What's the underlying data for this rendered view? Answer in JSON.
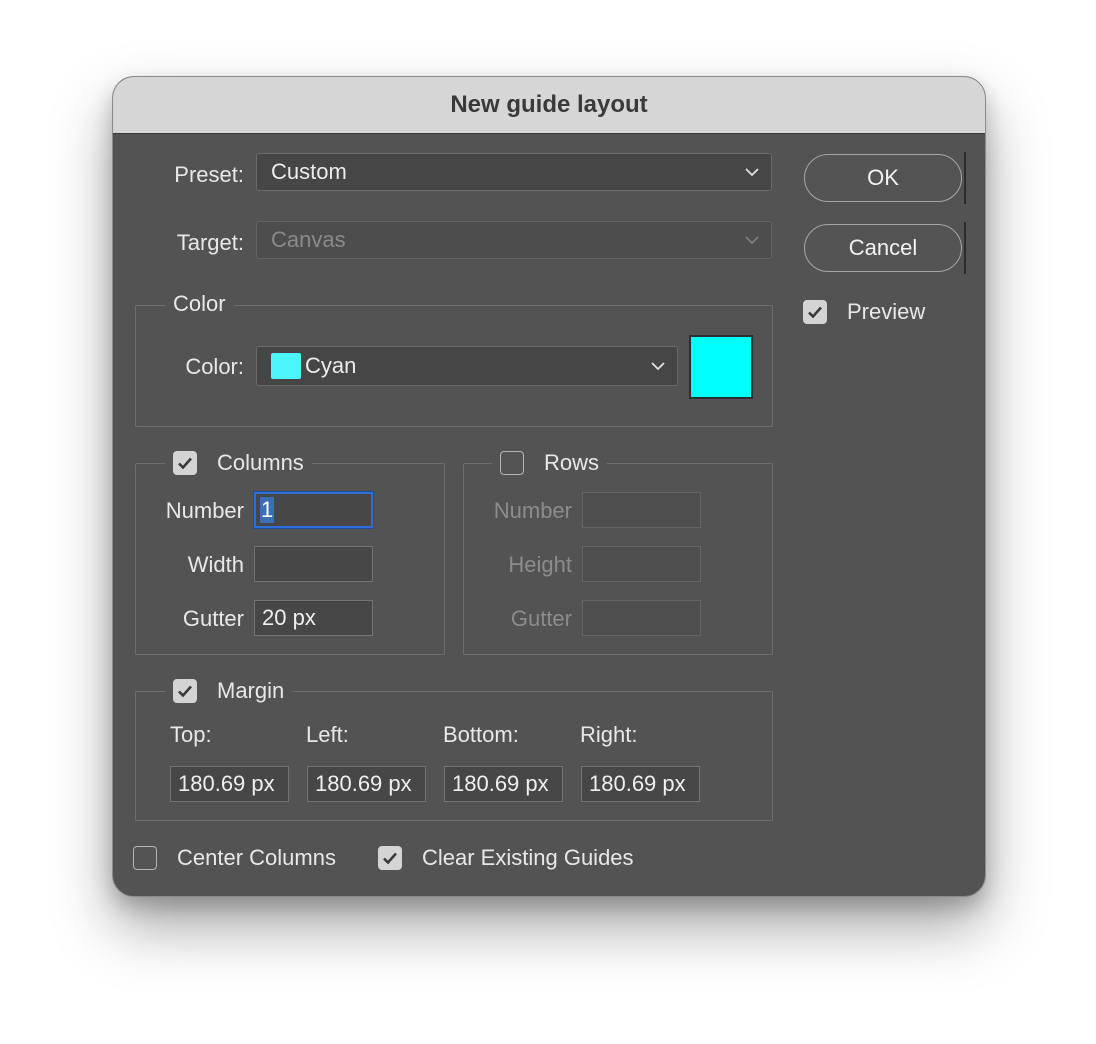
{
  "dialog": {
    "title": "New guide layout",
    "preset": {
      "label": "Preset:",
      "value": "Custom"
    },
    "target": {
      "label": "Target:",
      "value": "Canvas"
    },
    "color_group": {
      "legend": "Color",
      "label": "Color:",
      "value": "Cyan",
      "swatch_color": "#00ffff"
    },
    "columns": {
      "legend": "Columns",
      "checked": true,
      "number_label": "Number",
      "number_value": "1",
      "width_label": "Width",
      "width_value": "",
      "gutter_label": "Gutter",
      "gutter_value": "20 px"
    },
    "rows": {
      "legend": "Rows",
      "checked": false,
      "number_label": "Number",
      "height_label": "Height",
      "gutter_label": "Gutter"
    },
    "margin": {
      "legend": "Margin",
      "checked": true,
      "top_label": "Top:",
      "left_label": "Left:",
      "bottom_label": "Bottom:",
      "right_label": "Right:",
      "top_value": "180.69 px",
      "left_value": "180.69 px",
      "bottom_value": "180.69 px",
      "right_value": "180.69 px"
    },
    "center_columns": {
      "label": "Center Columns",
      "checked": false
    },
    "clear_guides": {
      "label": "Clear Existing Guides",
      "checked": true
    },
    "ok_label": "OK",
    "cancel_label": "Cancel",
    "preview": {
      "label": "Preview",
      "checked": true
    },
    "icons": {
      "chevron": "chevron-down-icon",
      "check": "checkmark-icon"
    }
  }
}
